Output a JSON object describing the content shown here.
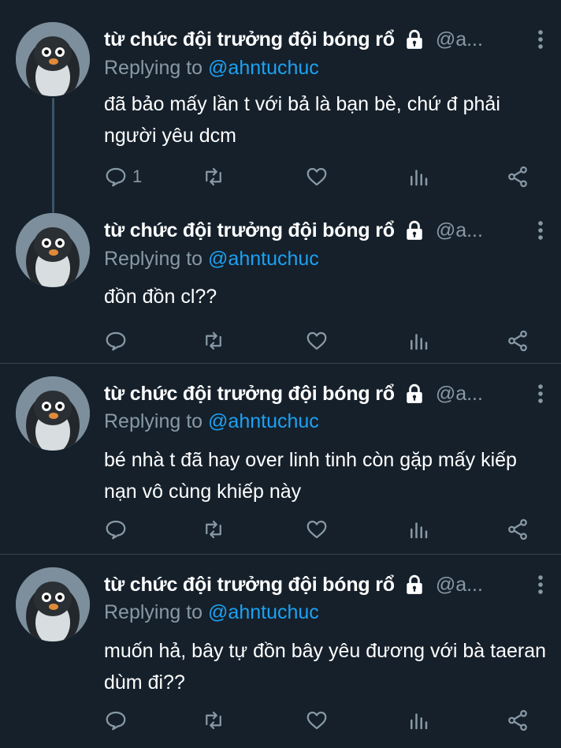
{
  "tweets": [
    {
      "display_name": "từ chức đội trưởng đội bóng rổ",
      "handle": "@a...",
      "replying_prefix": "Replying to",
      "replying_to": "@ahntuchuc",
      "text": "đã bảo mấy lần t với bả là bạn bè, chứ đ phải người yêu dcm",
      "reply_count": "1"
    },
    {
      "display_name": "từ chức đội trưởng đội bóng rổ",
      "handle": "@a...",
      "replying_prefix": "Replying to",
      "replying_to": "@ahntuchuc",
      "text": "đồn đồn cl??",
      "reply_count": ""
    },
    {
      "display_name": "từ chức đội trưởng đội bóng rổ",
      "handle": "@a...",
      "replying_prefix": "Replying to",
      "replying_to": "@ahntuchuc",
      "text": "bé nhà t đã hay over linh tinh còn gặp mấy kiếp nạn vô cùng khiếp này",
      "reply_count": ""
    },
    {
      "display_name": "từ chức đội trưởng đội bóng rổ",
      "handle": "@a...",
      "replying_prefix": "Replying to",
      "replying_to": "@ahntuchuc",
      "text": "muốn hả, bây tự đồn bây yêu đương với bà taeran dùm đi??",
      "reply_count": ""
    }
  ],
  "icons": {
    "reply": "reply-icon",
    "retweet": "retweet-icon",
    "like": "heart-icon",
    "analytics": "analytics-icon",
    "share": "share-icon",
    "protected": "lock-icon",
    "more": "more-icon"
  },
  "colors": {
    "background": "#15202b",
    "secondary_text": "#8899a6",
    "link": "#1da1f2",
    "divider": "#38444d"
  }
}
